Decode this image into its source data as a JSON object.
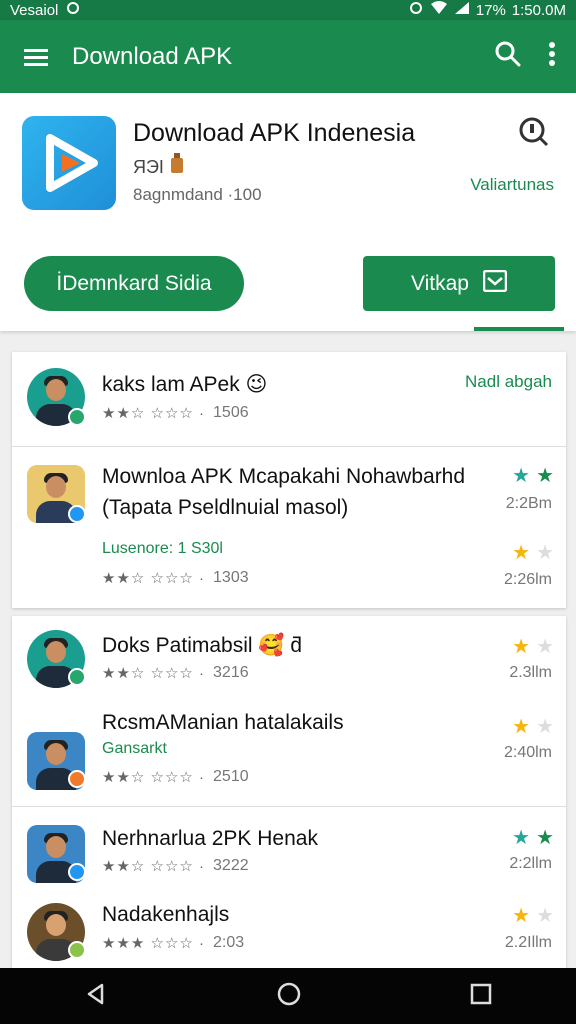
{
  "status_bar": {
    "carrier": "Vesaiol",
    "battery": "17%",
    "time": "1:50.0M"
  },
  "app_bar": {
    "title": "Download APK"
  },
  "header": {
    "app_name": "Download APK Indenesia",
    "subtitle": "ЯЭI",
    "meta": "8agnmdand ·100",
    "link": "Valiartunas",
    "primary_button": "İDemnkard Sidia",
    "secondary_button": "Vitkap"
  },
  "colors": {
    "primary": "#1b8a4f",
    "teal_star": "#26a69a",
    "gold_star": "#f5b50a"
  },
  "items": [
    {
      "title": "kaks lam APek 😉",
      "rating": "1506",
      "action": "Nadl abgah"
    },
    {
      "title": "Mownloa APK Mcapakahi Nohawbarhd",
      "title2": "(Tapata Pseldlnuial masol)",
      "extra": "Lusenore: 1 S30l",
      "rating": "1303",
      "time1": "2:2Bm",
      "time2": "2:26lm"
    },
    {
      "title": "Doks Patimabsil 🥰 ƌ",
      "rating": "3216",
      "time": "2.3llm"
    },
    {
      "title": "RcsmAManian hatalakails",
      "extra": "Gansarkt",
      "rating": "2510",
      "time": "2:40lm"
    },
    {
      "title": "Nerhnarlua 2PK Henak",
      "rating": "3222",
      "time": "2:2llm"
    },
    {
      "title": "Nadakenhajls",
      "rating": "2:03",
      "time": "2.2Illm"
    }
  ]
}
